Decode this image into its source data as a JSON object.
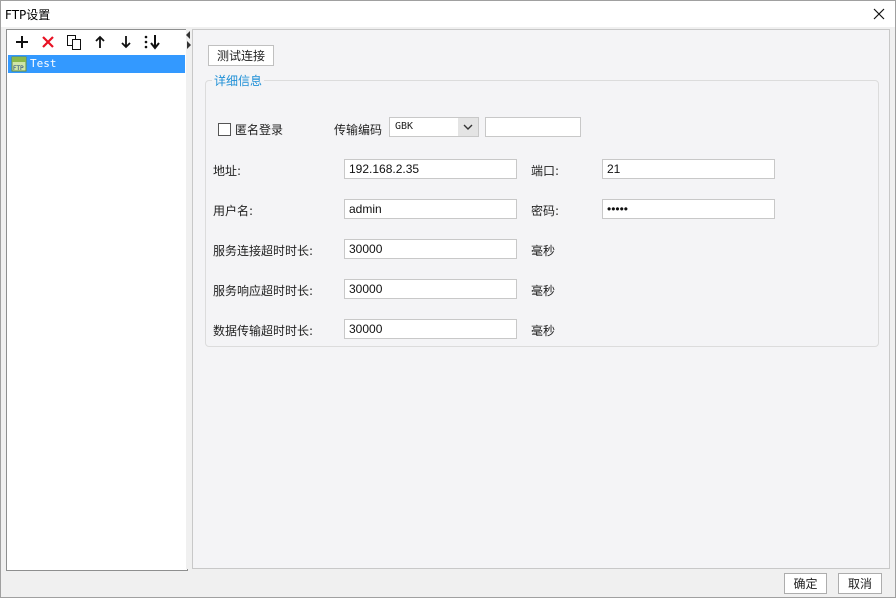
{
  "window": {
    "title": "FTP设置"
  },
  "tree": {
    "items": [
      {
        "label": "Test",
        "icon_text": "FTP"
      }
    ]
  },
  "toolbar": {
    "icons": [
      "plus-icon",
      "delete-icon",
      "copy-icon",
      "arrow-up-icon",
      "arrow-down-icon",
      "sort-icon"
    ]
  },
  "main": {
    "test_button": "测试连接",
    "group_title": "详细信息",
    "anonymous_label": "匿名登录",
    "anonymous_checked": false,
    "encoding_label": "传输编码",
    "encoding_value": "GBK",
    "encoding_extra_value": "",
    "address_label": "地址:",
    "address_value": "192.168.2.35",
    "port_label": "端口:",
    "port_value": "21",
    "username_label": "用户名:",
    "username_value": "admin",
    "password_label": "密码:",
    "password_value": "•••••",
    "connect_timeout_label": "服务连接超时时长:",
    "connect_timeout_value": "30000",
    "response_timeout_label": "服务响应超时时长:",
    "response_timeout_value": "30000",
    "transfer_timeout_label": "数据传输超时时长:",
    "transfer_timeout_value": "30000",
    "ms_unit": "毫秒"
  },
  "footer": {
    "ok": "确定",
    "cancel": "取消"
  },
  "colors": {
    "selection": "#3399ff",
    "group_title": "#1e8fd6",
    "delete": "#e81123"
  }
}
